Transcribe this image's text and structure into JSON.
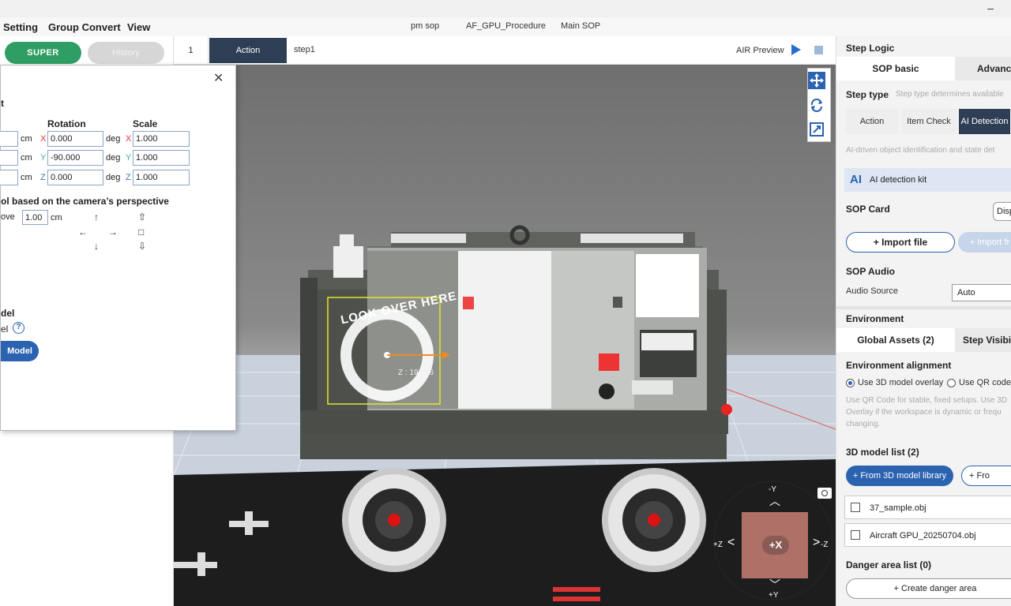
{
  "window": {
    "minimize_icon": "minimize-icon"
  },
  "menu": {
    "items": [
      "Setting",
      "Group Convert",
      "View"
    ],
    "doc_tabs": [
      "pm sop",
      "AF_GPU_Procedure",
      "Main SOP"
    ]
  },
  "left": {
    "super_label": "SUPER",
    "history_label": "History"
  },
  "tabrow": {
    "step_number": "1",
    "action_tab": "Action",
    "step_tab": "step1",
    "air_preview": "AIR Preview"
  },
  "dialog": {
    "section_letter": "t",
    "rotation_header": "Rotation",
    "scale_header": "Scale",
    "unit_cm": "cm",
    "unit_deg": "deg",
    "axis_x": "X",
    "axis_y": "Y",
    "axis_z": "Z",
    "rotation": {
      "x": "0.000",
      "y": "-90.000",
      "z": "0.000"
    },
    "scale": {
      "x": "1.000",
      "y": "1.000",
      "z": "1.000"
    },
    "camera_control_label": "ol based on the camera’s perspective",
    "move_label": "ove",
    "move_step": "1.00",
    "model_header": "del",
    "model_sub": "el",
    "model_button": "Model",
    "help": "?"
  },
  "viewport": {
    "gizmo_readout": "Z : 19.076",
    "sign_text": "LOOK OVER HERE",
    "axes": {
      "neg_y": "-Y",
      "pos_y": "+Y",
      "pos_z": "+Z",
      "neg_z": "-Z",
      "center": "+X"
    },
    "tool_icons": [
      "move-icon",
      "rotate-icon",
      "scale-icon"
    ]
  },
  "right_panel": {
    "step_logic": "Step Logic",
    "tabs": [
      "SOP basic",
      "Advance"
    ],
    "step_type_label": "Step type",
    "step_type_hint": "Step type determines available",
    "step_types": [
      "Action",
      "Item Check",
      "AI Detection"
    ],
    "step_type_selected": "AI Detection",
    "ai_hint": "AI-driven object identification and state det",
    "ai_kit_icon": "AI",
    "ai_kit_label": "AI detection kit",
    "sop_card": "SOP Card",
    "sop_card_button": "Disp",
    "import_file": "+ Import file",
    "import_disabled": "+ Import fr",
    "sop_audio": "SOP Audio",
    "audio_source_label": "Audio Source",
    "audio_source_value": "Auto",
    "environment": "Environment",
    "env_tabs": [
      "Global Assets (2)",
      "Step Visibi"
    ],
    "env_alignment": "Environment alignment",
    "radio_3d": "Use 3D model overlay",
    "radio_qr": "Use QR code",
    "env_hint": "Use QR Code for stable, fixed setups. Use 3D Overlay if the workspace is dynamic or frequ changing.",
    "model_list_title": "3D model list (2)",
    "from_library": "+ From 3D model library",
    "from_other": "+ Fro",
    "models": [
      "37_sample.obj",
      "Aircraft GPU_20250704.obj"
    ],
    "danger_title": "Danger area list (0)",
    "create_danger": "+ Create danger area"
  }
}
